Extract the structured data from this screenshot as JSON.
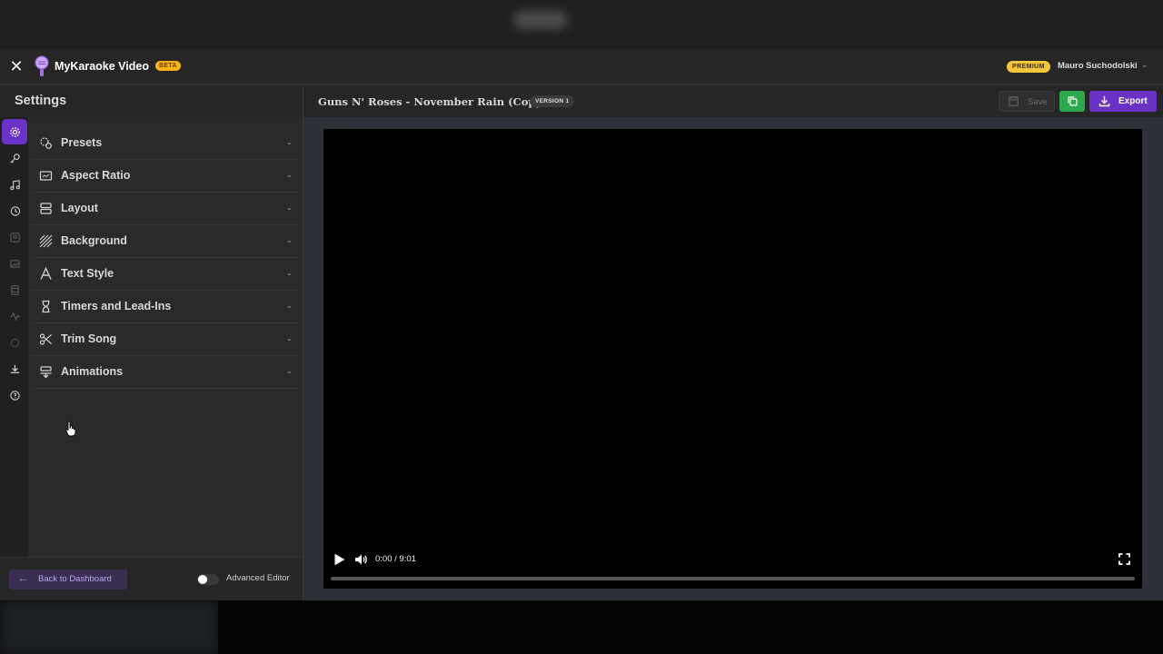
{
  "app": {
    "brand": "MyKaraoke Video",
    "beta_badge": "BETA",
    "premium_badge": "PREMIUM",
    "user_name": "Mauro Suchodolski"
  },
  "sidebar": {
    "title": "Settings",
    "rail_icons": [
      "gear-icon",
      "key-icon",
      "music-note-icon",
      "history-icon",
      "portrait-icon",
      "image-icon",
      "film-icon",
      "waveform-icon",
      "coin-icon",
      "download-icon",
      "help-icon"
    ],
    "items": [
      {
        "label": "Presets",
        "icon": "presets-icon"
      },
      {
        "label": "Aspect Ratio",
        "icon": "aspect-ratio-icon"
      },
      {
        "label": "Layout",
        "icon": "layout-icon"
      },
      {
        "label": "Background",
        "icon": "background-icon"
      },
      {
        "label": "Text Style",
        "icon": "text-style-icon"
      },
      {
        "label": "Timers and Lead-Ins",
        "icon": "hourglass-icon"
      },
      {
        "label": "Trim Song",
        "icon": "scissors-icon"
      },
      {
        "label": "Animations",
        "icon": "animations-icon"
      }
    ],
    "back_label": "Back to Dashboard",
    "advanced_editor_label": "Advanced Editor",
    "advanced_editor_on": false
  },
  "editor": {
    "song_title": "Guns N' Roses - November Rain (Copy)",
    "version_badge": "VERSION 1",
    "save_label": "Save",
    "export_label": "Export"
  },
  "player": {
    "time": "0:00 / 9:01",
    "progress": 0
  },
  "colors": {
    "accent": "#6b32c8",
    "duplicate": "#2ea84c",
    "premium": "#f4c73a",
    "beta": "#f6b417"
  }
}
